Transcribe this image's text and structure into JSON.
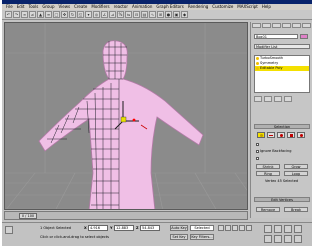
{
  "menu": [
    "File",
    "Edit",
    "Tools",
    "Group",
    "Views",
    "Create",
    "Modifiers",
    "reactor",
    "Animation",
    "Graph Editors",
    "Rendering",
    "Customize",
    "MAXScript",
    "Help"
  ],
  "viewport": {
    "label": "Perspective"
  },
  "panel": {
    "object_name": "Box01",
    "modifier_list": "Modifier List",
    "stack": [
      {
        "label": "TurboSmooth",
        "selected": false
      },
      {
        "label": "Symmetry",
        "selected": false
      },
      {
        "label": "Editable Poly",
        "selected": true
      }
    ],
    "selection_header": "Selection",
    "ignore_backfacing": "Ignore Backfacing",
    "shrink": "Shrink",
    "grow": "Grow",
    "ring": "Ring",
    "loop": "Loop",
    "vertex_selected": "Vertex 45 Selected",
    "edit_vertices_header": "Edit Vertices",
    "remove": "Remove",
    "break": "Break"
  },
  "timeline": {
    "slider": "0 / 100"
  },
  "status": {
    "line1": "1 Object Selected",
    "line2": "Click or click-and-drag to select objects",
    "x": "4.916",
    "y": "12.883",
    "z": "54.843",
    "auto_key": "Auto Key",
    "set_key": "Set Key",
    "selected": "Selected",
    "key_filters": "Key Filters..."
  },
  "colors": {
    "mesh_fill": "#f0bfe6",
    "mesh_shade": "#b47aa8",
    "wire": "#1e1e28",
    "selected_yellow": "#f4e000",
    "viewport_bg": "#8b8b8b"
  }
}
